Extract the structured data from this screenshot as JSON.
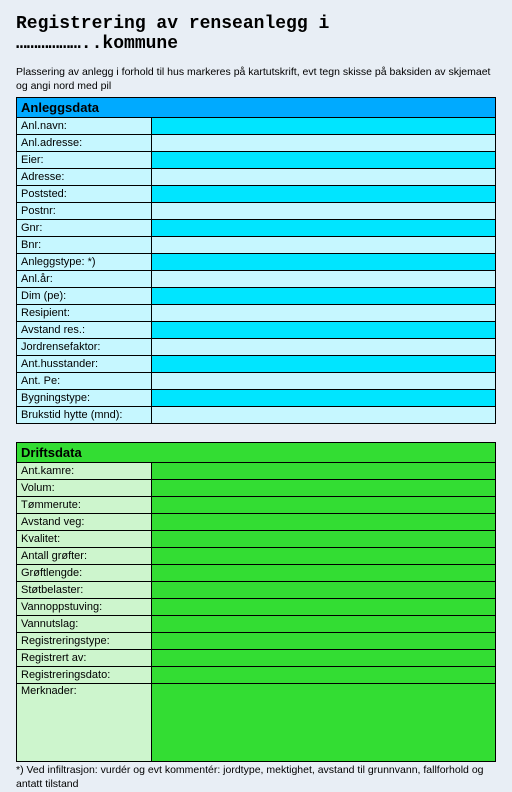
{
  "title": "Registrering av renseanlegg i ………………..kommune",
  "instructions": "Plassering av anlegg i forhold til hus markeres på kartutskrift, evt tegn skisse på baksiden av skjemaet og angi nord  med pil",
  "anleggsdata": {
    "header": "Anleggsdata",
    "rows": [
      {
        "label": "Anl.navn:",
        "value": ""
      },
      {
        "label": "Anl.adresse:",
        "value": ""
      },
      {
        "label": "Eier:",
        "value": ""
      },
      {
        "label": "Adresse:",
        "value": ""
      },
      {
        "label": "Poststed:",
        "value": ""
      },
      {
        "label": "Postnr:",
        "value": ""
      },
      {
        "label": "Gnr:",
        "value": ""
      },
      {
        "label": "Bnr:",
        "value": ""
      },
      {
        "label": "Anleggstype: *)",
        "value": ""
      },
      {
        "label": "Anl.år:",
        "value": ""
      },
      {
        "label": "Dim (pe):",
        "value": ""
      },
      {
        "label": "Resipient:",
        "value": ""
      },
      {
        "label": "Avstand res.:",
        "value": ""
      },
      {
        "label": "Jordrensefaktor:",
        "value": ""
      },
      {
        "label": "Ant.husstander:",
        "value": ""
      },
      {
        "label": "Ant. Pe:",
        "value": ""
      },
      {
        "label": "Bygningstype:",
        "value": ""
      },
      {
        "label": "Brukstid hytte (mnd):",
        "value": ""
      }
    ]
  },
  "driftsdata": {
    "header": "Driftsdata",
    "rows": [
      {
        "label": "Ant.kamre:",
        "value": ""
      },
      {
        "label": "Volum:",
        "value": ""
      },
      {
        "label": "Tømmerute:",
        "value": ""
      },
      {
        "label": "Avstand veg:",
        "value": ""
      },
      {
        "label": "Kvalitet:",
        "value": ""
      },
      {
        "label": "Antall grøfter:",
        "value": ""
      },
      {
        "label": "Grøftlengde:",
        "value": ""
      },
      {
        "label": "Støtbelaster:",
        "value": ""
      },
      {
        "label": "Vannoppstuving:",
        "value": ""
      },
      {
        "label": "Vannutslag:",
        "value": ""
      },
      {
        "label": "Registreringstype:",
        "value": ""
      },
      {
        "label": "Registrert av:",
        "value": ""
      },
      {
        "label": "Registreringsdato:",
        "value": ""
      },
      {
        "label": "Merknader:",
        "value": ""
      }
    ]
  },
  "footnote": "*) Ved infiltrasjon:  vurdér og evt kommentér: jordtype, mektighet, avstand til grunnvann, fallforhold og antatt tilstand"
}
